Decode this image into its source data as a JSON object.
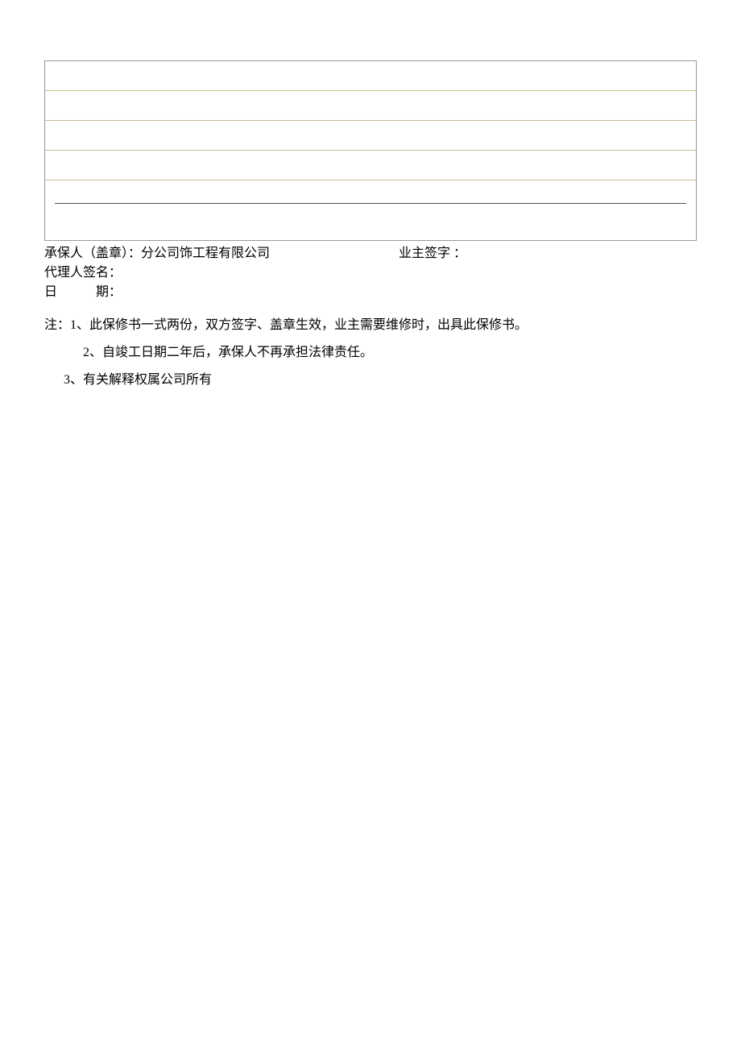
{
  "signature": {
    "insurer_label": "承保人（盖章）：分公司饰工程有限公司",
    "owner_label": "业主签字 ：",
    "agent_label": "代理人签名：",
    "date_label": "日　　　期："
  },
  "notes": {
    "n1": "注：1、此保修书一式两份，双方签字、盖章生效，业主需要维修时，出具此保修书。",
    "n2": "2、自竣工日期二年后，承保人不再承担法律责任。",
    "n3": "3、有关解释权属公司所有"
  }
}
